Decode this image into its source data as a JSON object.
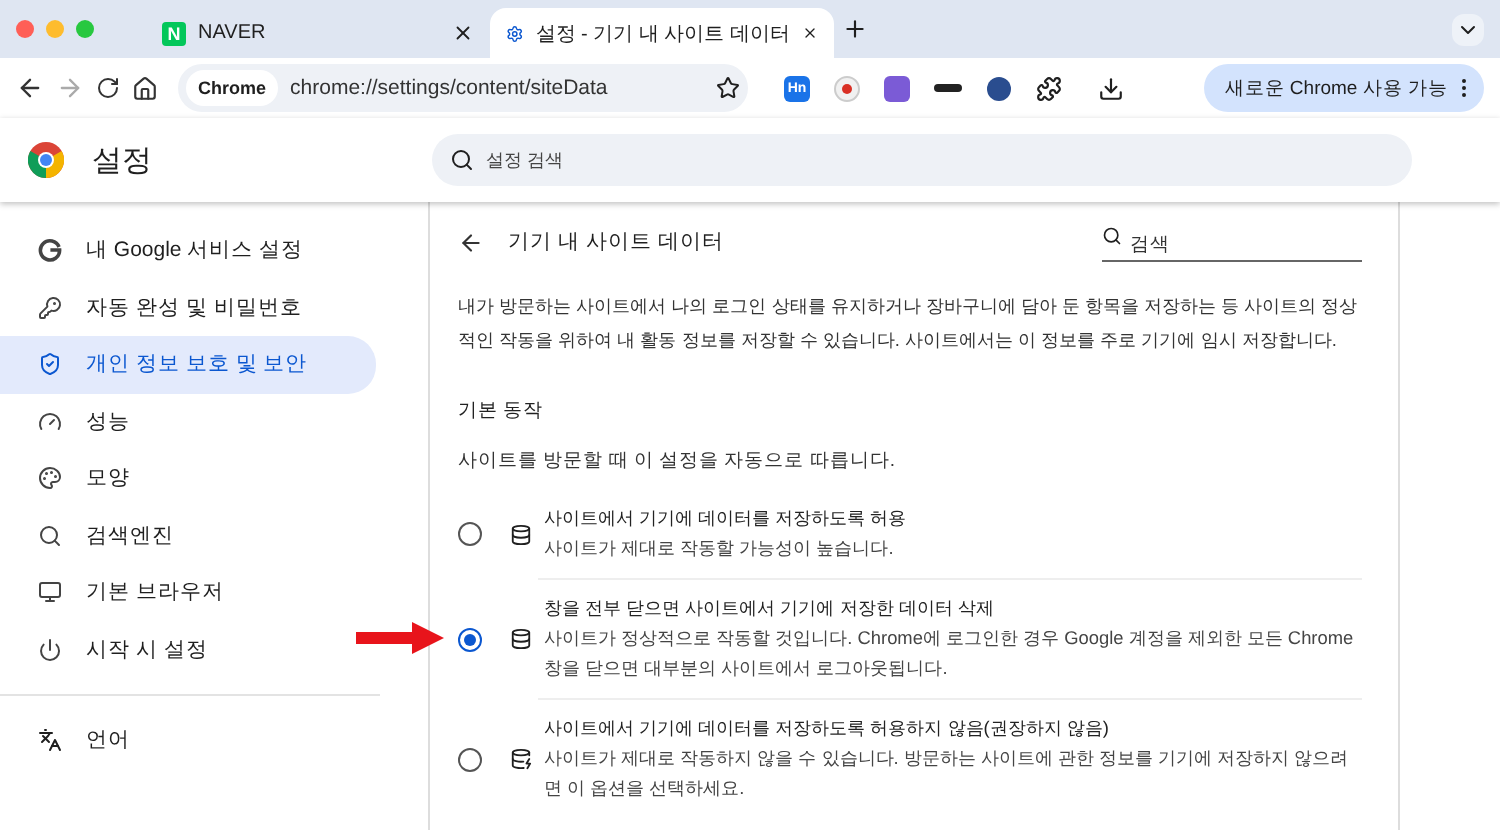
{
  "browser": {
    "tabs": [
      {
        "title": "NAVER",
        "favicon": "N",
        "selected": false
      },
      {
        "title": "설정 - 기기 내 사이트 데이터",
        "selected": true
      }
    ],
    "address": {
      "chip": "Chrome",
      "url": "chrome://settings/content/siteData"
    },
    "extension_badge": "Hn",
    "update_button": "새로운 Chrome 사용 가능"
  },
  "header": {
    "title": "설정",
    "search": {
      "placeholder": "설정 검색"
    }
  },
  "sidebar": {
    "items": [
      {
        "label": "내 Google 서비스 설정",
        "selected": false
      },
      {
        "label": "자동 완성 및 비밀번호",
        "selected": false
      },
      {
        "label": "개인 정보 보호 및 보안",
        "selected": true
      },
      {
        "label": "성능",
        "selected": false
      },
      {
        "label": "모양",
        "selected": false
      },
      {
        "label": "검색엔진",
        "selected": false
      },
      {
        "label": "기본 브라우저",
        "selected": false
      },
      {
        "label": "시작 시 설정",
        "selected": false
      }
    ],
    "more_items": [
      {
        "label": "언어",
        "selected": false
      }
    ]
  },
  "page": {
    "title": "기기 내 사이트 데이터",
    "search": {
      "placeholder": "검색"
    },
    "description": "내가 방문하는 사이트에서 나의 로그인 상태를 유지하거나 장바구니에 담아 둔 항목을 저장하는 등 사이트의 정상적인 작동을 위하여 내 활동 정보를 저장할 수 있습니다. 사이트에서는 이 정보를 주로 기기에 임시 저장합니다.",
    "section_title": "기본 동작",
    "section_subtitle": "사이트를 방문할 때 이 설정을 자동으로 따릅니다.",
    "options": [
      {
        "kind": "allow",
        "title": "사이트에서 기기에 데이터를 저장하도록 허용",
        "description": "사이트가 제대로 작동할 가능성이 높습니다.",
        "selected": false
      },
      {
        "kind": "allow",
        "title": "창을 전부 닫으면 사이트에서 기기에 저장한 데이터 삭제",
        "description": "사이트가 정상적으로 작동할 것입니다. Chrome에 로그인한 경우 Google 계정을 제외한 모든 Chrome 창을 닫으면 대부분의 사이트에서 로그아웃됩니다.",
        "selected": true
      },
      {
        "kind": "block",
        "title": "사이트에서 기기에 데이터를 저장하도록 허용하지 않음(권장하지 않음)",
        "description": "사이트가 제대로 작동하지 않을 수 있습니다. 방문하는 사이트에 관한 정보를 기기에 저장하지 않으려면 이 옵션을 선택하세요.",
        "selected": false
      }
    ]
  }
}
